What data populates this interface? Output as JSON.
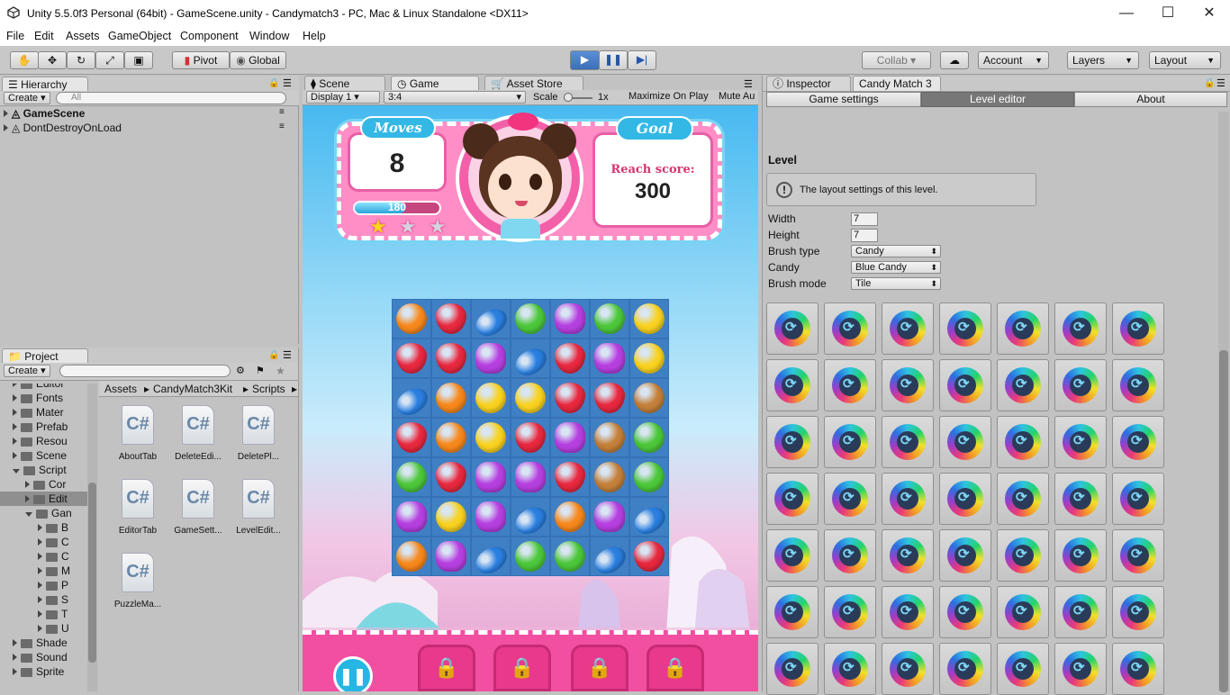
{
  "window": {
    "title": "Unity 5.5.0f3 Personal (64bit) - GameScene.unity - Candymatch3 - PC, Mac & Linux Standalone <DX11>"
  },
  "menu": [
    "File",
    "Edit",
    "Assets",
    "GameObject",
    "Component",
    "Window",
    "Help"
  ],
  "toolbar": {
    "pivot": "Pivot",
    "global": "Global",
    "collab": "Collab ▾",
    "account": "Account",
    "layers": "Layers",
    "layout": "Layout"
  },
  "hierarchy": {
    "tab": "Hierarchy",
    "create": "Create",
    "search_placeholder": "All",
    "items": [
      "GameScene",
      "DontDestroyOnLoad"
    ]
  },
  "project": {
    "tab": "Project",
    "create": "Create",
    "tree": [
      {
        "label": "Editor",
        "depth": 1,
        "expanded": false
      },
      {
        "label": "Fonts",
        "depth": 1,
        "expanded": false
      },
      {
        "label": "Mater",
        "depth": 1,
        "expanded": false
      },
      {
        "label": "Prefab",
        "depth": 1,
        "expanded": false
      },
      {
        "label": "Resou",
        "depth": 1,
        "expanded": false
      },
      {
        "label": "Scene",
        "depth": 1,
        "expanded": false
      },
      {
        "label": "Script",
        "depth": 1,
        "expanded": true
      },
      {
        "label": "Cor",
        "depth": 2,
        "expanded": false
      },
      {
        "label": "Edit",
        "depth": 2,
        "expanded": false,
        "selected": true
      },
      {
        "label": "Gan",
        "depth": 2,
        "expanded": true
      },
      {
        "label": "B",
        "depth": 3,
        "expanded": false
      },
      {
        "label": "C",
        "depth": 3,
        "expanded": false
      },
      {
        "label": "C",
        "depth": 3,
        "expanded": false
      },
      {
        "label": "M",
        "depth": 3,
        "expanded": false
      },
      {
        "label": "P",
        "depth": 3,
        "expanded": false
      },
      {
        "label": "S",
        "depth": 3,
        "expanded": false
      },
      {
        "label": "T",
        "depth": 3,
        "expanded": false
      },
      {
        "label": "U",
        "depth": 3,
        "expanded": false
      },
      {
        "label": "Shade",
        "depth": 1,
        "expanded": false
      },
      {
        "label": "Sound",
        "depth": 1,
        "expanded": false
      },
      {
        "label": "Sprite",
        "depth": 1,
        "expanded": false
      }
    ],
    "breadcrumb": [
      "Assets",
      "CandyMatch3Kit",
      "Scripts"
    ],
    "assets": [
      "AboutTab",
      "DeleteEdi...",
      "DeletePl...",
      "EditorTab",
      "GameSett...",
      "LevelEdit...",
      "PuzzleMa..."
    ]
  },
  "center": {
    "tabs": [
      "Scene",
      "Game",
      "Asset Store"
    ],
    "display": "Display 1",
    "aspect": "3:4",
    "scale_label": "Scale",
    "scale_value": "1x",
    "maximize": "Maximize On Play",
    "mute": "Mute Au"
  },
  "game": {
    "moves_label": "Moves",
    "moves": "8",
    "score": "180",
    "goal_label": "Goal",
    "goal_text": "Reach score:",
    "goal_value": "300",
    "stars_earned": 1,
    "stars_total": 3,
    "board": [
      [
        "orange",
        "red",
        "blue",
        "green",
        "purple",
        "green",
        "yellow"
      ],
      [
        "red",
        "red",
        "purple",
        "blue",
        "red",
        "purple",
        "yellow"
      ],
      [
        "blue",
        "orange",
        "yellow",
        "yellow",
        "red",
        "red",
        "brown"
      ],
      [
        "red",
        "orange",
        "yellow",
        "red",
        "purple",
        "brown",
        "green"
      ],
      [
        "green",
        "red",
        "purple",
        "purple",
        "red",
        "brown",
        "green"
      ],
      [
        "purple",
        "yellow",
        "purple",
        "blue",
        "orange",
        "purple",
        "blue"
      ],
      [
        "orange",
        "purple",
        "blue",
        "green",
        "green",
        "blue",
        "red"
      ]
    ],
    "candy_colors": {
      "orange": "#f7881c",
      "red": "#e8283f",
      "blue": "#2a7fe0",
      "green": "#4cc73a",
      "purple": "#b63fe0",
      "yellow": "#f9d21f",
      "brown": "#c4803a"
    }
  },
  "inspector": {
    "tabs": [
      "Inspector",
      "Candy Match 3"
    ],
    "subtabs": [
      "Game settings",
      "Level editor",
      "About"
    ],
    "section": "Level",
    "help": "The layout settings of this level.",
    "fields": [
      {
        "label": "Width",
        "value": "7",
        "type": "input"
      },
      {
        "label": "Height",
        "value": "7",
        "type": "input"
      },
      {
        "label": "Brush type",
        "value": "Candy",
        "type": "dropdown"
      },
      {
        "label": "Candy",
        "value": "Blue Candy",
        "type": "dropdown"
      },
      {
        "label": "Brush mode",
        "value": "Tile",
        "type": "dropdown"
      }
    ],
    "grid_rows": 7,
    "grid_cols": 7
  }
}
